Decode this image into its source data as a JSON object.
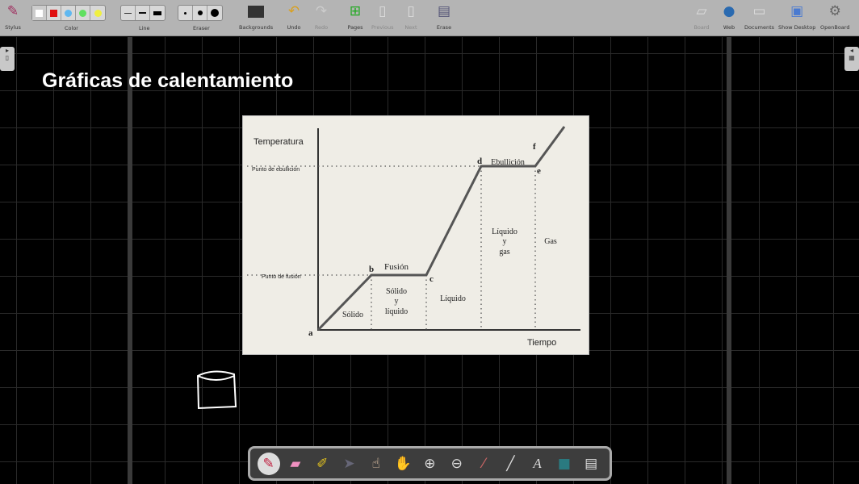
{
  "toolbar": {
    "stylus": "Stylus",
    "color": "Color",
    "line": "Line",
    "eraser": "Eraser",
    "backgrounds": "Backgrounds",
    "undo": "Undo",
    "redo": "Redo",
    "pages": "Pages",
    "previous": "Previous",
    "next": "Next",
    "erase": "Erase",
    "board": "Board",
    "web": "Web",
    "documents": "Documents",
    "show_desktop": "Show Desktop",
    "openboard": "OpenBoard",
    "colors": [
      "#ffffff",
      "#e01010",
      "#60b8f0",
      "#60e060",
      "#f0f040"
    ]
  },
  "board": {
    "title": "Gráficas de calentamiento"
  },
  "chart_image": {
    "y_label": "Temperatura",
    "x_label": "Tiempo",
    "boiling_point": "Punto de ebullición",
    "melting_point": "Punto de fusión",
    "points": [
      "a",
      "b",
      "c",
      "d",
      "e",
      "f"
    ],
    "phases": {
      "fusion": "Fusión",
      "ebullicion": "Ebullición",
      "solido": "Sólido",
      "solido_y_liquido": [
        "Sólido",
        "y",
        "líquido"
      ],
      "liquido": "Líquido",
      "liquido_y_gas": [
        "Líquido",
        "y",
        "gas"
      ],
      "gas": "Gas"
    }
  }
}
